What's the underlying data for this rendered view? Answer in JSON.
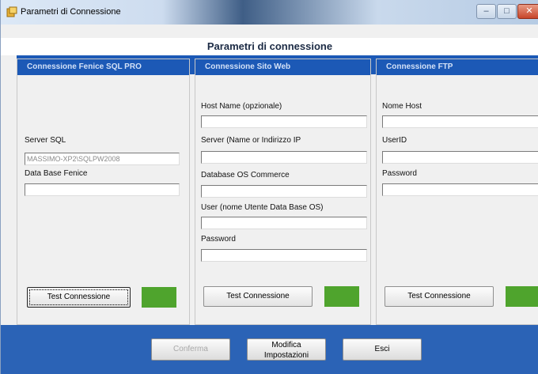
{
  "window": {
    "title": "Parametri di Connessione",
    "controls": {
      "minimize": "–",
      "maximize": "□",
      "close": "✕"
    }
  },
  "header": {
    "title": "Parametri di connessione"
  },
  "panels": {
    "sql": {
      "title": "Connessione Fenice SQL PRO",
      "server_label": "Server SQL",
      "server_value": "MASSIMO-XP2\\SQLPW2008",
      "db_label": "Data Base Fenice",
      "db_value": "",
      "test_button": "Test Connessione"
    },
    "web": {
      "title": "Connessione Sito Web",
      "host_label": "Host Name (opzionale)",
      "host_value": "",
      "server_label": "Server (Name or Indirizzo IP",
      "server_value": "",
      "db_label": "Database OS Commerce",
      "db_value": "",
      "user_label": "User (nome Utente Data Base OS)",
      "user_value": "",
      "password_label": "Password",
      "password_value": "",
      "test_button": "Test Connessione"
    },
    "ftp": {
      "title": "Connessione FTP",
      "host_label": "Nome Host",
      "host_value": "",
      "user_label": "UserID",
      "user_value": "",
      "password_label": "Password",
      "password_value": "",
      "test_button": "Test Connessione"
    }
  },
  "footer": {
    "confirm_button": "Conferma",
    "edit_button_line1": "Modifica",
    "edit_button_line2": "Impostazioni",
    "exit_button": "Esci"
  },
  "colors": {
    "panel_header": "#1c59b6",
    "footer": "#2b63b6",
    "status_ok": "#4fa42d"
  }
}
